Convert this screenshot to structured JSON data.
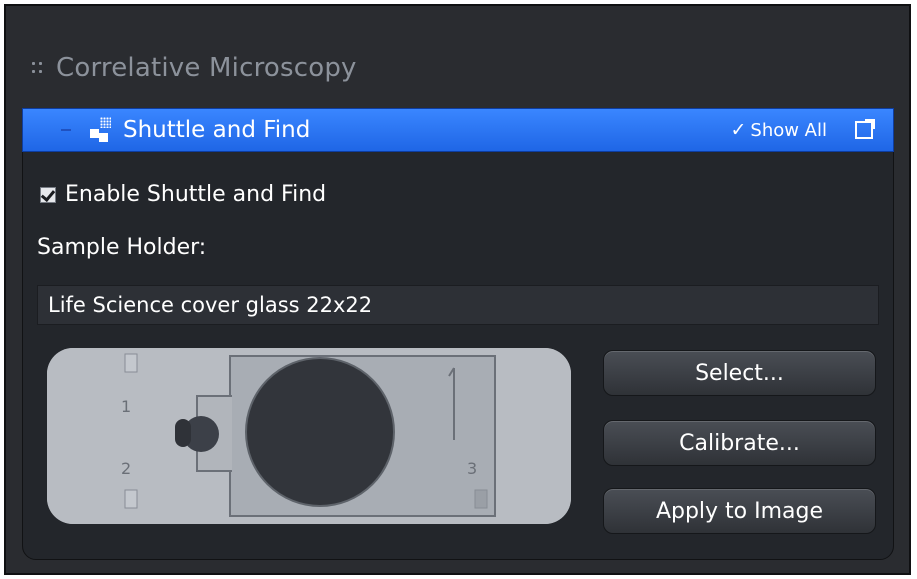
{
  "section": {
    "title": "Correlative Microscopy",
    "icon": "grip-icon"
  },
  "panel": {
    "title": "Shuttle and Find",
    "header_color": "#2a78f5",
    "show_all_label": "Show All",
    "icons": [
      "collapse-icon",
      "shuttle-find-icon",
      "checkmark-icon",
      "popout-icon"
    ]
  },
  "enable": {
    "label": "Enable Shuttle and Find",
    "checked": true
  },
  "sample_holder": {
    "label": "Sample Holder:",
    "value": "Life Science cover glass 22x22",
    "markers": [
      "1",
      "2",
      "3"
    ]
  },
  "buttons": {
    "select": "Select...",
    "calibrate": "Calibrate...",
    "apply": "Apply to Image"
  }
}
